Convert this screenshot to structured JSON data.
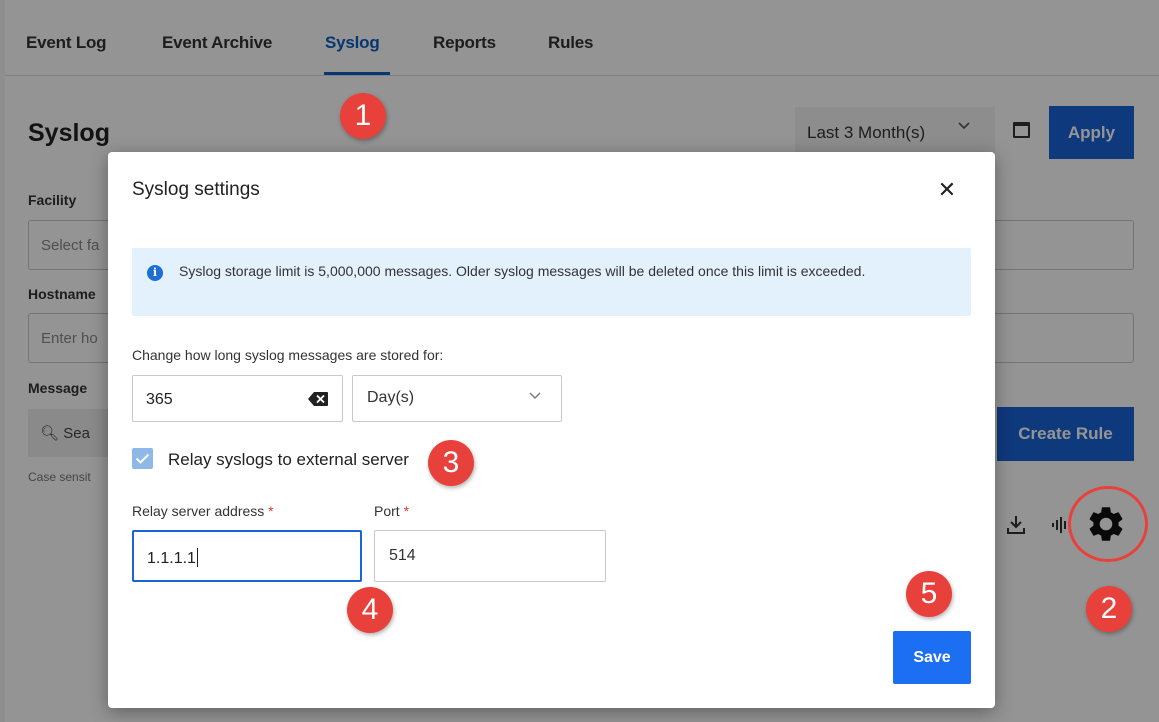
{
  "tabs": [
    "Event Log",
    "Event Archive",
    "Syslog",
    "Reports",
    "Rules"
  ],
  "page": {
    "title": "Syslog",
    "date_range": "Last 3 Month(s)",
    "apply_label": "Apply",
    "facility_label": "Facility",
    "facility_placeholder": "Select fa",
    "hostname_label": "Hostname",
    "hostname_placeholder": "Enter ho",
    "message_label": "Message",
    "search_placeholder": "Sea",
    "case_note": "Case sensit",
    "create_rule_label": "Create Rule"
  },
  "modal": {
    "title": "Syslog settings",
    "close_glyph": "✕",
    "info_icon": "i",
    "info_text": "Syslog storage limit is 5,000,000 messages. Older syslog messages will be deleted once this limit is exceeded.",
    "retention_label": "Change how long syslog messages are stored for:",
    "retention_value": "365",
    "retention_unit": "Day(s)",
    "relay_label": "Relay syslogs to external server",
    "relay_checked": true,
    "address_label": "Relay server address",
    "port_label": "Port",
    "required_mark": "*",
    "address_value": "1.1.1.1",
    "port_value": "514",
    "save_label": "Save"
  },
  "callouts": [
    "1",
    "2",
    "3",
    "4",
    "5"
  ],
  "colors": {
    "accent": "#1a63d8",
    "callout": "#e8413c",
    "info_bg": "#e3f1fc"
  }
}
